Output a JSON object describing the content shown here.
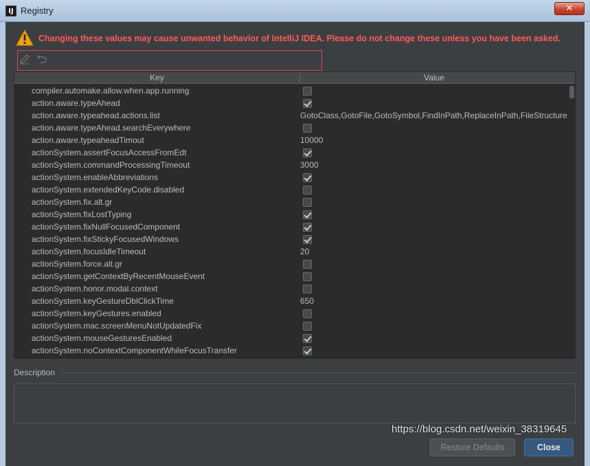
{
  "window": {
    "title": "Registry",
    "app_icon_text": "IJ",
    "close_glyph": "✕"
  },
  "warning": {
    "icon": "warning-icon",
    "text": "Changing these values may cause unwanted behavior of IntelliJ IDEA. Please do not change these unless you have been asked."
  },
  "toolbar": {
    "edit_icon": "pencil-icon",
    "revert_icon": "undo-icon"
  },
  "table": {
    "columns": [
      "Key",
      "Value"
    ],
    "rows": [
      {
        "key": "compiler.automake.allow.when.app.running",
        "type": "bool",
        "checked": false
      },
      {
        "key": "action.aware.typeAhead",
        "type": "bool",
        "checked": true
      },
      {
        "key": "action.aware.typeahead.actions.list",
        "type": "text",
        "value": "GotoClass,GotoFile,GotoSymbol,FindInPath,ReplaceInPath,FileStructure"
      },
      {
        "key": "action.aware.typeAhead.searchEverywhere",
        "type": "bool",
        "checked": false
      },
      {
        "key": "action.aware.typeaheadTimout",
        "type": "text",
        "value": "10000"
      },
      {
        "key": "actionSystem.assertFocusAccessFromEdt",
        "type": "bool",
        "checked": true
      },
      {
        "key": "actionSystem.commandProcessingTimeout",
        "type": "text",
        "value": "3000"
      },
      {
        "key": "actionSystem.enableAbbreviations",
        "type": "bool",
        "checked": true
      },
      {
        "key": "actionSystem.extendedKeyCode.disabled",
        "type": "bool",
        "checked": false
      },
      {
        "key": "actionSystem.fix.alt.gr",
        "type": "bool",
        "checked": false
      },
      {
        "key": "actionSystem.fixLostTyping",
        "type": "bool",
        "checked": true
      },
      {
        "key": "actionSystem.fixNullFocusedComponent",
        "type": "bool",
        "checked": true
      },
      {
        "key": "actionSystem.fixStickyFocusedWindows",
        "type": "bool",
        "checked": true
      },
      {
        "key": "actionSystem.focusIdleTimeout",
        "type": "text",
        "value": "20"
      },
      {
        "key": "actionSystem.force.alt.gr",
        "type": "bool",
        "checked": false
      },
      {
        "key": "actionSystem.getContextByRecentMouseEvent",
        "type": "bool",
        "checked": false
      },
      {
        "key": "actionSystem.honor.modal.context",
        "type": "bool",
        "checked": false
      },
      {
        "key": "actionSystem.keyGestureDblClickTime",
        "type": "text",
        "value": "650"
      },
      {
        "key": "actionSystem.keyGestures.enabled",
        "type": "bool",
        "checked": false
      },
      {
        "key": "actionSystem.mac.screenMenuNotUpdatedFix",
        "type": "bool",
        "checked": false
      },
      {
        "key": "actionSystem.mouseGesturesEnabled",
        "type": "bool",
        "checked": true
      },
      {
        "key": "actionSystem.noContextComponentWhileFocusTransfer",
        "type": "bool",
        "checked": true
      }
    ]
  },
  "description": {
    "label": "Description",
    "text": ""
  },
  "buttons": {
    "restore_defaults": "Restore Defaults",
    "close": "Close"
  },
  "watermark": "https://blog.csdn.net/weixin_38319645",
  "colors": {
    "background": "#3c3f41",
    "table_bg": "#2b2b2b",
    "warning_text": "#ff5a5a",
    "highlight_border": "#d64a4a",
    "close_button": "#365880"
  }
}
